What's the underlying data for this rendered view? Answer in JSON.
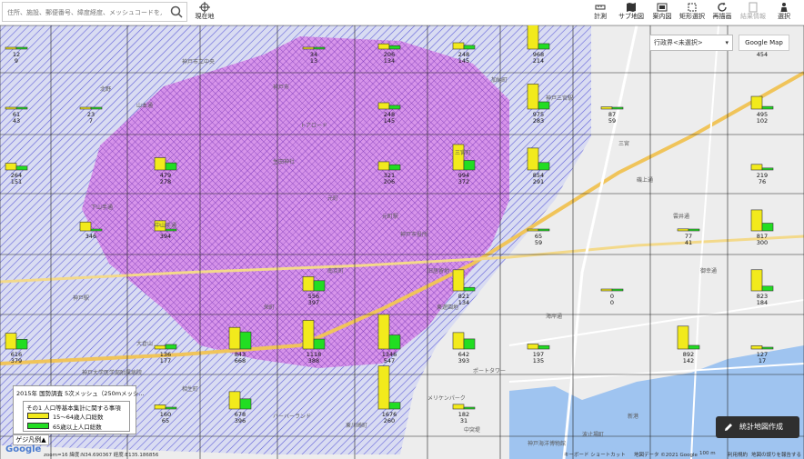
{
  "search": {
    "placeholder": "住所、施設、郵便番号、緯度経度、メッシュコードを入力"
  },
  "current_location_label": "現在地",
  "tools": [
    {
      "label": "計測"
    },
    {
      "label": "サブ地図"
    },
    {
      "label": "案内図"
    },
    {
      "label": "矩形選択"
    },
    {
      "label": "再描画"
    },
    {
      "label": "結果情報"
    },
    {
      "label": "選択"
    }
  ],
  "region_select": "行政界<未選択>",
  "basemap_label": "Google Map",
  "legend": {
    "title": "2015年 国勢調査 5次メッシュ（250mメッシ...",
    "subtitle": "その1 人口等基本集計に関する事項",
    "items": [
      {
        "label": "15〜64歳人口総数",
        "color": "#f2ea1c"
      },
      {
        "label": "65歳以上人口総数",
        "color": "#22dd22"
      }
    ]
  },
  "legend_toggle": "ゲジ凡例▲",
  "create_button": "統計地図作成",
  "footer": {
    "zoom": "zoom=16 緯度:N34.690367 経度:E135.186856",
    "shortcut": "キーボード ショートカット",
    "copyright": "地図データ ©2021 Google",
    "scale": "100 m",
    "terms": "利用規約",
    "report": "地図の誤りを報告する"
  },
  "place_labels": [
    "神戸市立中央",
    "神戸市",
    "北野",
    "山本通",
    "トアロード",
    "三宮",
    "生田神社",
    "神戸三宮駅",
    "元町",
    "元町駅",
    "神戸駅",
    "大倉山",
    "神戸大学医学部附属病院",
    "旧居留地",
    "東遊園地",
    "神戸市役所",
    "南京町",
    "メリケンパーク",
    "ハーバーランド",
    "中突堤",
    "新港",
    "ポートタワー",
    "栄町",
    "中山手通",
    "下山手通",
    "相生町",
    "三宮町",
    "磯上通",
    "雲井通",
    "加納町",
    "御幸通",
    "海岸通",
    "波止場町",
    "東川崎町",
    "神戸海洋博物館"
  ],
  "chart_data": {
    "type": "bar",
    "title": "2015年 国勢調査 5次メッシュ（250mメッシ...",
    "series": [
      {
        "name": "15〜64歳人口総数"
      },
      {
        "name": "65歳以上人口総数"
      }
    ],
    "labels": [
      {
        "top": "12",
        "bottom": "9"
      },
      {
        "top": "34",
        "bottom": "13"
      },
      {
        "top": "206",
        "bottom": "134"
      },
      {
        "top": "248",
        "bottom": "145"
      },
      {
        "top": "968",
        "bottom": "214"
      },
      {
        "top": "454",
        "bottom": ""
      },
      {
        "top": "61",
        "bottom": "43"
      },
      {
        "top": "23",
        "bottom": "7"
      },
      {
        "top": "248",
        "bottom": "145"
      },
      {
        "top": "975",
        "bottom": "283"
      },
      {
        "top": "87",
        "bottom": "59"
      },
      {
        "top": "495",
        "bottom": "102"
      },
      {
        "top": "264",
        "bottom": "151"
      },
      {
        "top": "479",
        "bottom": "278"
      },
      {
        "top": "321",
        "bottom": "206"
      },
      {
        "top": "994",
        "bottom": "372"
      },
      {
        "top": "854",
        "bottom": "291"
      },
      {
        "top": "219",
        "bottom": "76"
      },
      {
        "top": "346",
        "bottom": ""
      },
      {
        "top": "394",
        "bottom": ""
      },
      {
        "top": "65",
        "bottom": "59"
      },
      {
        "top": "77",
        "bottom": "41"
      },
      {
        "top": "817",
        "bottom": "300"
      },
      {
        "top": "556",
        "bottom": "397"
      },
      {
        "top": "821",
        "bottom": "134"
      },
      {
        "top": "0",
        "bottom": "0"
      },
      {
        "top": "823",
        "bottom": "184"
      },
      {
        "top": "616",
        "bottom": "379"
      },
      {
        "top": "136",
        "bottom": "177"
      },
      {
        "top": "843",
        "bottom": "668"
      },
      {
        "top": "1118",
        "bottom": "388"
      },
      {
        "top": "1346",
        "bottom": "547"
      },
      {
        "top": "642",
        "bottom": "393"
      },
      {
        "top": "197",
        "bottom": "135"
      },
      {
        "top": "892",
        "bottom": "142"
      },
      {
        "top": "127",
        "bottom": "17"
      },
      {
        "top": "160",
        "bottom": "65"
      },
      {
        "top": "678",
        "bottom": "396"
      },
      {
        "top": "1676",
        "bottom": "260"
      },
      {
        "top": "182",
        "bottom": "31"
      }
    ]
  }
}
